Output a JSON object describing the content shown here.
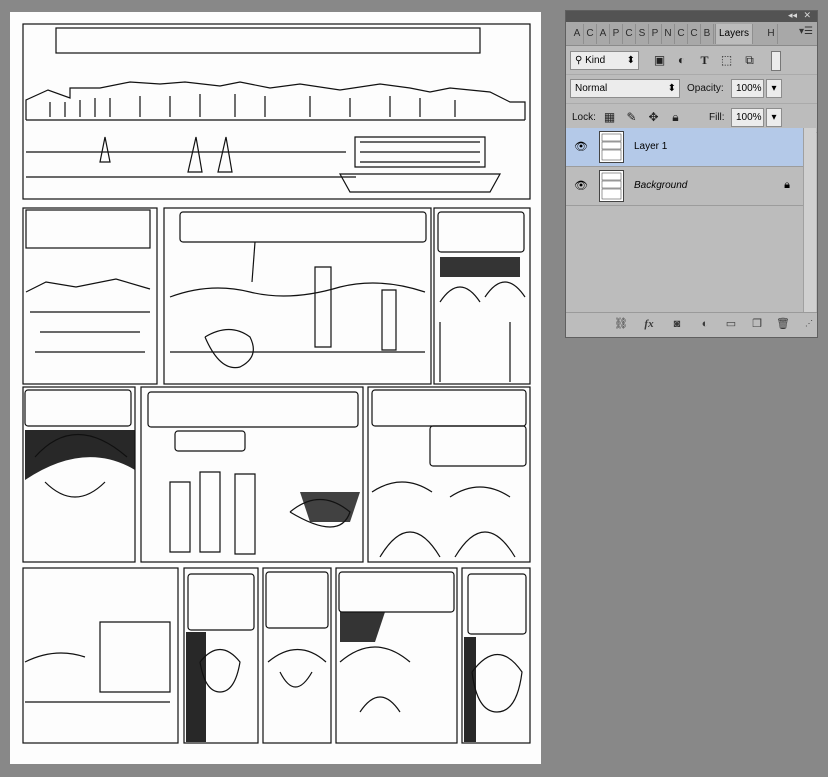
{
  "panel": {
    "collapse_icon": "double-chevron-left",
    "close_icon": "close",
    "tabs": [
      "A",
      "C",
      "A",
      "P",
      "C",
      "S",
      "P",
      "N",
      "C",
      "C",
      "B"
    ],
    "active_tab": "Layers",
    "next_tab": "H",
    "filter": {
      "label": "Kind"
    },
    "blend_mode": "Normal",
    "opacity_label": "Opacity:",
    "opacity_value": "100%",
    "lock_label": "Lock:",
    "fill_label": "Fill:",
    "fill_value": "100%",
    "layers": [
      {
        "name": "Layer 1",
        "selected": true,
        "visible": true,
        "locked": false
      },
      {
        "name": "Background",
        "selected": false,
        "visible": true,
        "locked": true
      }
    ],
    "footer_icons": [
      "link-icon",
      "fx-icon",
      "mask-icon",
      "adjustment-icon",
      "folder-icon",
      "new-layer-icon",
      "trash-icon"
    ],
    "fx_label": "fx"
  },
  "colors": {
    "workspace": "#888888",
    "panel_bg": "#bcbcbc",
    "selected_layer": "#b4c9e8",
    "titlebar": "#535353"
  }
}
